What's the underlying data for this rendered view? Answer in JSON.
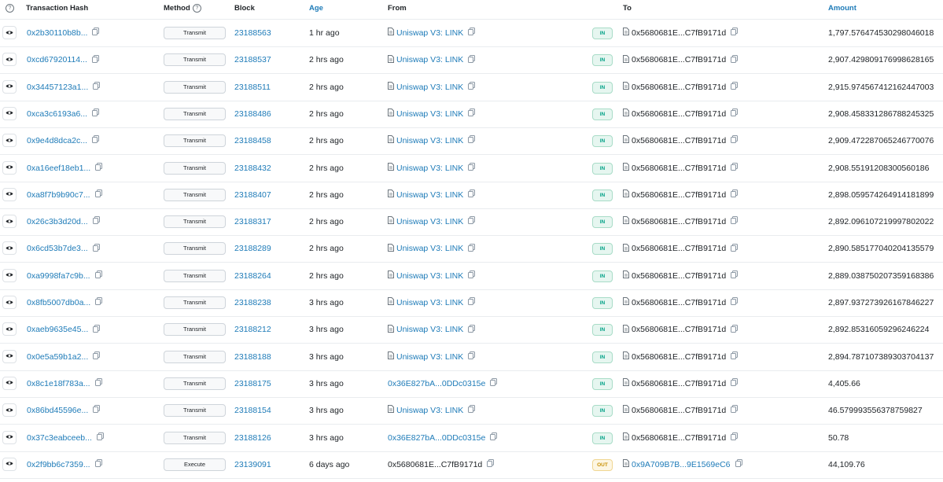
{
  "columns": {
    "hash": "Transaction Hash",
    "method": "Method",
    "block": "Block",
    "age": "Age",
    "from": "From",
    "to": "To",
    "amount": "Amount"
  },
  "rows": [
    {
      "hash": "0x2b30110b8b...",
      "method": "Transmit",
      "block": "23188563",
      "age": "1 hr ago",
      "from": "Uniswap V3: LINK",
      "from_is_contract": true,
      "direction": "IN",
      "to": "0x5680681E...C7fB9171d",
      "amount": "1,797.576474530298046018"
    },
    {
      "hash": "0xcd67920114...",
      "method": "Transmit",
      "block": "23188537",
      "age": "2 hrs ago",
      "from": "Uniswap V3: LINK",
      "from_is_contract": true,
      "direction": "IN",
      "to": "0x5680681E...C7fB9171d",
      "amount": "2,907.429809176998628165"
    },
    {
      "hash": "0x34457123a1...",
      "method": "Transmit",
      "block": "23188511",
      "age": "2 hrs ago",
      "from": "Uniswap V3: LINK",
      "from_is_contract": true,
      "direction": "IN",
      "to": "0x5680681E...C7fB9171d",
      "amount": "2,915.974567412162447003"
    },
    {
      "hash": "0xca3c6193a6...",
      "method": "Transmit",
      "block": "23188486",
      "age": "2 hrs ago",
      "from": "Uniswap V3: LINK",
      "from_is_contract": true,
      "direction": "IN",
      "to": "0x5680681E...C7fB9171d",
      "amount": "2,908.458331286788245325"
    },
    {
      "hash": "0x9e4d8dca2c...",
      "method": "Transmit",
      "block": "23188458",
      "age": "2 hrs ago",
      "from": "Uniswap V3: LINK",
      "from_is_contract": true,
      "direction": "IN",
      "to": "0x5680681E...C7fB9171d",
      "amount": "2,909.472287065246770076"
    },
    {
      "hash": "0xa16eef18eb1...",
      "method": "Transmit",
      "block": "23188432",
      "age": "2 hrs ago",
      "from": "Uniswap V3: LINK",
      "from_is_contract": true,
      "direction": "IN",
      "to": "0x5680681E...C7fB9171d",
      "amount": "2,908.55191208300560186"
    },
    {
      "hash": "0xa8f7b9b90c7...",
      "method": "Transmit",
      "block": "23188407",
      "age": "2 hrs ago",
      "from": "Uniswap V3: LINK",
      "from_is_contract": true,
      "direction": "IN",
      "to": "0x5680681E...C7fB9171d",
      "amount": "2,898.059574264914181899"
    },
    {
      "hash": "0x26c3b3d20d...",
      "method": "Transmit",
      "block": "23188317",
      "age": "2 hrs ago",
      "from": "Uniswap V3: LINK",
      "from_is_contract": true,
      "direction": "IN",
      "to": "0x5680681E...C7fB9171d",
      "amount": "2,892.096107219997802022"
    },
    {
      "hash": "0x6cd53b7de3...",
      "method": "Transmit",
      "block": "23188289",
      "age": "2 hrs ago",
      "from": "Uniswap V3: LINK",
      "from_is_contract": true,
      "direction": "IN",
      "to": "0x5680681E...C7fB9171d",
      "amount": "2,890.585177040204135579"
    },
    {
      "hash": "0xa9998fa7c9b...",
      "method": "Transmit",
      "block": "23188264",
      "age": "2 hrs ago",
      "from": "Uniswap V3: LINK",
      "from_is_contract": true,
      "direction": "IN",
      "to": "0x5680681E...C7fB9171d",
      "amount": "2,889.038750207359168386"
    },
    {
      "hash": "0x8fb5007db0a...",
      "method": "Transmit",
      "block": "23188238",
      "age": "3 hrs ago",
      "from": "Uniswap V3: LINK",
      "from_is_contract": true,
      "direction": "IN",
      "to": "0x5680681E...C7fB9171d",
      "amount": "2,897.937273926167846227"
    },
    {
      "hash": "0xaeb9635e45...",
      "method": "Transmit",
      "block": "23188212",
      "age": "3 hrs ago",
      "from": "Uniswap V3: LINK",
      "from_is_contract": true,
      "direction": "IN",
      "to": "0x5680681E...C7fB9171d",
      "amount": "2,892.85316059296246224"
    },
    {
      "hash": "0x0e5a59b1a2...",
      "method": "Transmit",
      "block": "23188188",
      "age": "3 hrs ago",
      "from": "Uniswap V3: LINK",
      "from_is_contract": true,
      "direction": "IN",
      "to": "0x5680681E...C7fB9171d",
      "amount": "2,894.787107389303704137"
    },
    {
      "hash": "0x8c1e18f783a...",
      "method": "Transmit",
      "block": "23188175",
      "age": "3 hrs ago",
      "from": "0x36E827bA...0DDc0315e",
      "from_is_contract": false,
      "from_is_link": true,
      "direction": "IN",
      "to": "0x5680681E...C7fB9171d",
      "amount": "4,405.66"
    },
    {
      "hash": "0x86bd45596e...",
      "method": "Transmit",
      "block": "23188154",
      "age": "3 hrs ago",
      "from": "Uniswap V3: LINK",
      "from_is_contract": true,
      "direction": "IN",
      "to": "0x5680681E...C7fB9171d",
      "amount": "46.579993556378759827"
    },
    {
      "hash": "0x37c3eabceeb...",
      "method": "Transmit",
      "block": "23188126",
      "age": "3 hrs ago",
      "from": "0x36E827bA...0DDc0315e",
      "from_is_contract": false,
      "from_is_link": true,
      "direction": "IN",
      "to": "0x5680681E...C7fB9171d",
      "amount": "50.78"
    },
    {
      "hash": "0x2f9bb6c7359...",
      "method": "Execute",
      "block": "23139091",
      "age": "6 days ago",
      "from": "0x5680681E...C7fB9171d",
      "from_is_contract": false,
      "from_is_link": false,
      "direction": "OUT",
      "to": "0x9A709B7B...9E1569eC6",
      "to_is_link": true,
      "amount": "44,109.76"
    }
  ],
  "colors": {
    "link": "#1e7bb8",
    "in_badge": "#00a186",
    "out_badge": "#c89004"
  }
}
